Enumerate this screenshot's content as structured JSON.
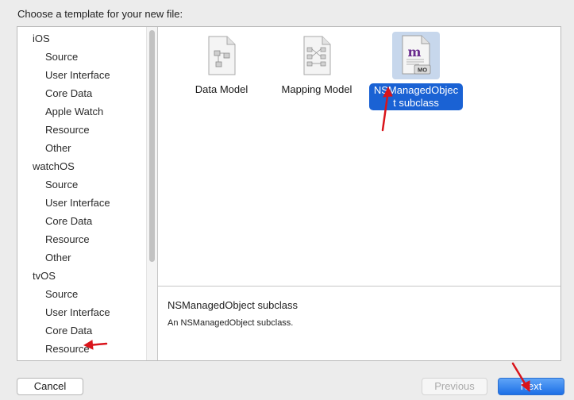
{
  "dialog": {
    "prompt": "Choose a template for your new file:"
  },
  "sidebar": {
    "sections": [
      {
        "title": "iOS",
        "items": [
          "Source",
          "User Interface",
          "Core Data",
          "Apple Watch",
          "Resource",
          "Other"
        ]
      },
      {
        "title": "watchOS",
        "items": [
          "Source",
          "User Interface",
          "Core Data",
          "Resource",
          "Other"
        ]
      },
      {
        "title": "tvOS",
        "items": [
          "Source",
          "User Interface",
          "Core Data",
          "Resource"
        ]
      }
    ]
  },
  "templates": [
    {
      "label": "Data Model",
      "icon": "data-model-file-icon",
      "selected": false
    },
    {
      "label": "Mapping Model",
      "icon": "mapping-model-file-icon",
      "selected": false
    },
    {
      "label": "NSManagedObject subclass",
      "icon": "managed-object-file-icon",
      "selected": true,
      "badge_letter": "m",
      "badge_text": "MO"
    }
  ],
  "description": {
    "title": "NSManagedObject subclass",
    "text": "An NSManagedObject subclass."
  },
  "buttons": {
    "cancel": "Cancel",
    "previous": "Previous",
    "next": "Next"
  },
  "colors": {
    "selection_blue": "#1a62d4",
    "selection_highlight": "#c7d7ec",
    "annotation_red": "#d9141b",
    "default_button": "#1c6fe6"
  }
}
